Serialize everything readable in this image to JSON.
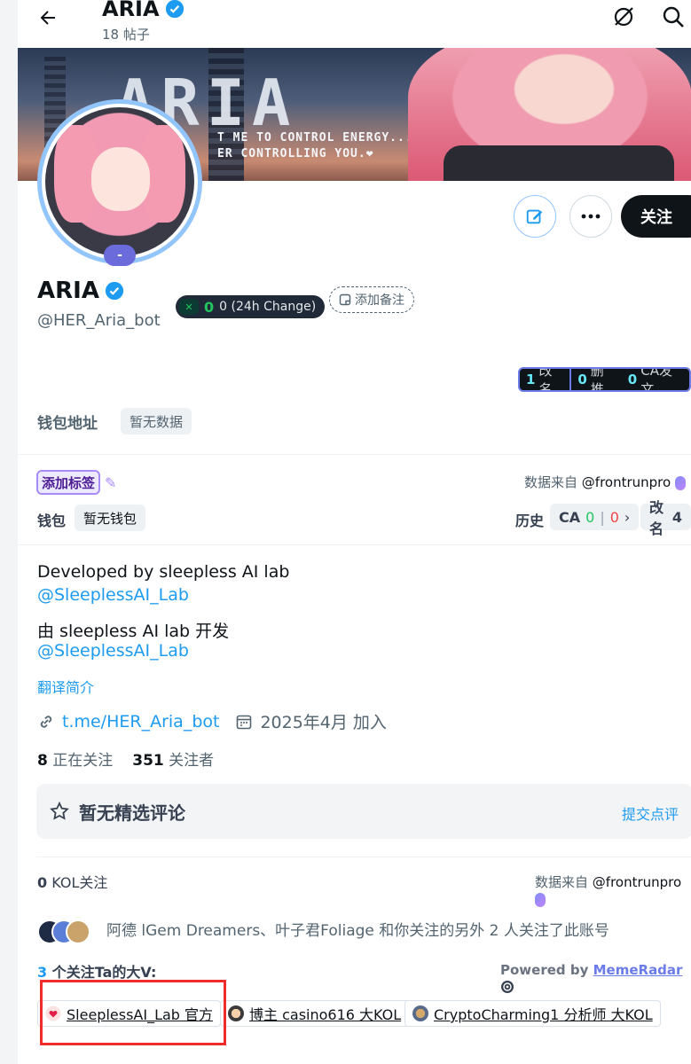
{
  "header": {
    "title": "ARIA",
    "post_count": "18 帖子"
  },
  "banner": {
    "big_text": "ARIA",
    "line1": "T ME TO CONTROL ENERGY...",
    "line2": "ER CONTROLLING YOU.❤"
  },
  "avatar": {
    "badge": "-"
  },
  "actions": {
    "follow_label": "关注"
  },
  "profile": {
    "name": "ARIA",
    "handle": "@HER_Aria_bot",
    "token_value": "0",
    "token_change": "0 (24h Change)",
    "add_note": "添加备注"
  },
  "stats": [
    {
      "count": "1",
      "label": "改名"
    },
    {
      "count": "0",
      "label": "删推"
    },
    {
      "count": "0",
      "label": "CA发文"
    }
  ],
  "wallet_address": {
    "label": "钱包地址",
    "value": "暂无数据"
  },
  "tags": {
    "add_tag": "添加标签",
    "source_prefix": "数据来自",
    "source_handle": "@frontrunpro",
    "wallet_label": "钱包",
    "wallet_value": "暂无钱包",
    "history_label": "历史",
    "history_ca": "CA",
    "history_green": "0",
    "history_red": "0",
    "rename_label": "改名",
    "rename_count": "4"
  },
  "bio": {
    "line1": "Developed by sleepless AI lab",
    "mention1": "@SleeplessAI_Lab",
    "line2": "由 sleepless AI lab 开发",
    "mention2": "@SleeplessAI_Lab",
    "translate": "翻译简介"
  },
  "meta": {
    "link": "t.me/HER_Aria_bot",
    "joined": "2025年4月 加入"
  },
  "follow_counts": {
    "following": "8",
    "following_label": "正在关注",
    "followers": "351",
    "followers_label": "关注者"
  },
  "featured": {
    "title": "暂无精选评论",
    "submit": "提交点评"
  },
  "kol": {
    "count": "0",
    "label": "KOL关注",
    "source_prefix": "数据来自",
    "source_handle": "@frontrunpro"
  },
  "mutual_text": "阿德 lGem Dreamers、叶子君Foliage 和你关注的另外 2 人关注了此账号",
  "bigv": {
    "count": "3",
    "label": " 个关注Ta的大V:",
    "powered_prefix": "Powered by",
    "powered_link": "MemeRadar",
    "chips": [
      {
        "name": "SleeplessAI_Lab 官方"
      },
      {
        "name": "博主 casino616 大KOL"
      },
      {
        "name": "CryptoCharming1 分析师 大KOL"
      }
    ]
  },
  "colors": {
    "link": "#1d9bf0",
    "highlight_box": "#ef2b2b",
    "stats_border": "#6b7be8"
  }
}
